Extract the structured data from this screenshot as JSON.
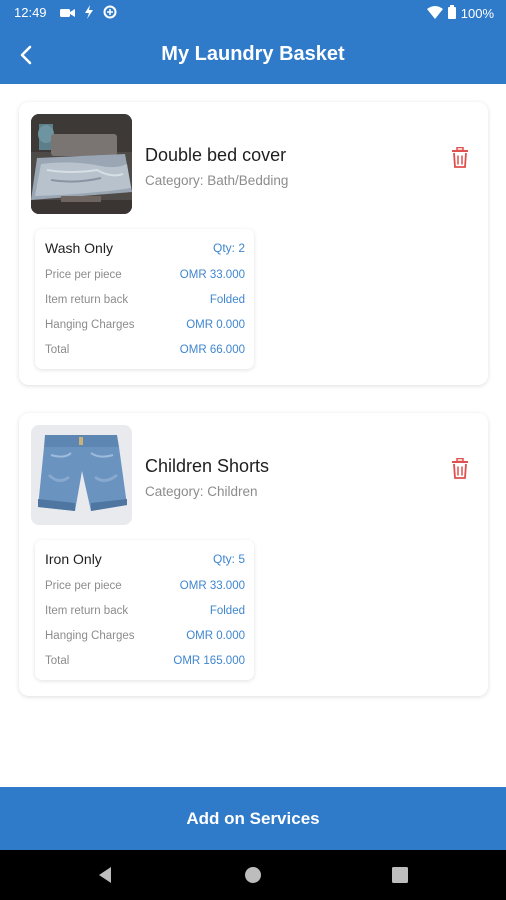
{
  "status_bar": {
    "time": "12:49",
    "battery": "100%",
    "left_icons": [
      "video-icon",
      "data-saver-icon",
      "vpn-icon"
    ],
    "right_icons": [
      "wifi-icon",
      "battery-icon"
    ]
  },
  "app_bar": {
    "title": "My Laundry Basket",
    "back_icon": "back-arrow-icon"
  },
  "basket_items": [
    {
      "name": "Double bed cover",
      "category": "Category: Bath/Bedding",
      "service": "Wash Only",
      "qty": "Qty: 2",
      "rows": [
        {
          "label": "Price per piece",
          "value": "OMR 33.000"
        },
        {
          "label": "Item return back",
          "value": "Folded"
        },
        {
          "label": "Hanging Charges",
          "value": "OMR 0.000"
        },
        {
          "label": "Total",
          "value": "OMR 66.000"
        }
      ]
    },
    {
      "name": "Children Shorts",
      "category": "Category: Children",
      "service": "Iron Only",
      "qty": "Qty: 5",
      "rows": [
        {
          "label": "Price per piece",
          "value": "OMR 33.000"
        },
        {
          "label": "Item return back",
          "value": "Folded"
        },
        {
          "label": "Hanging Charges",
          "value": "OMR 0.000"
        },
        {
          "label": "Total",
          "value": "OMR 165.000"
        }
      ]
    }
  ],
  "add_on_button": "Add on Services",
  "colors": {
    "primary": "#2f7ac9",
    "accent_text": "#3f86cf",
    "delete": "#e0504f",
    "muted_text": "#8c8c8c"
  }
}
